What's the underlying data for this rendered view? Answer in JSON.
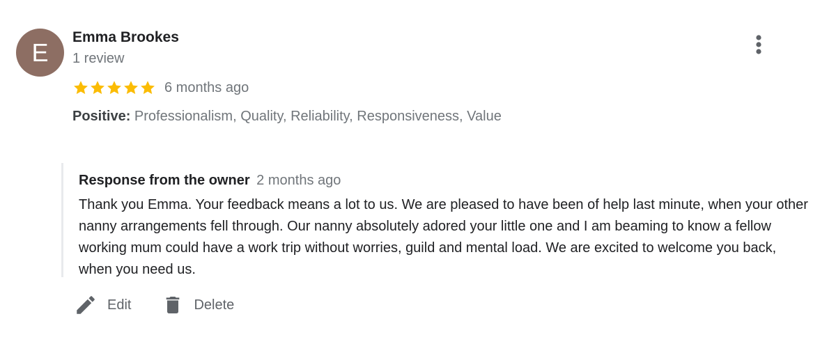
{
  "review": {
    "avatar_letter": "E",
    "reviewer_name": "Emma Brookes",
    "review_count": "1 review",
    "rating": 5,
    "rating_max": 5,
    "time": "6 months ago",
    "positive_label": "Positive:",
    "positive_values": "Professionalism, Quality, Reliability, Responsiveness, Value",
    "more_icon": "more-vert-icon",
    "star_color": "#fbbc04",
    "avatar_color": "#8d6e63"
  },
  "owner_response": {
    "title": "Response from the owner",
    "time": "2 months ago",
    "text": "Thank you Emma. Your feedback means a lot to us. We are pleased to have been of help last minute, when your other nanny arrangements fell through. Our nanny absolutely adored your little one and I am beaming to know a fellow working mum could have a work trip without worries, guild and mental load. We are excited to welcome you back, when you need us."
  },
  "actions": {
    "edit_label": "Edit",
    "edit_icon": "pencil-icon",
    "delete_label": "Delete",
    "delete_icon": "trash-icon"
  }
}
